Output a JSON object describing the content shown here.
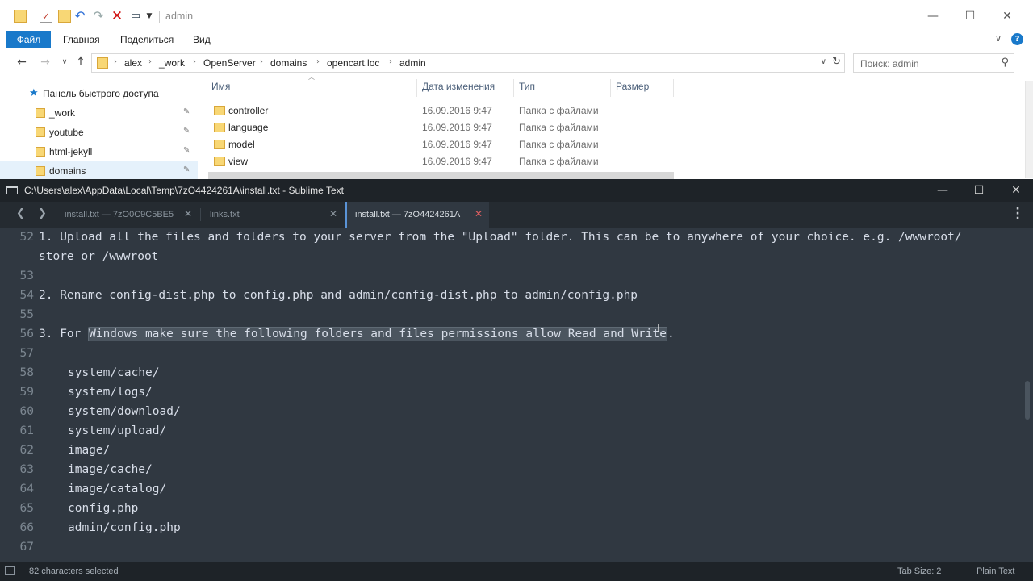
{
  "explorer": {
    "window_title": "admin",
    "ribbon_tabs": [
      "Файл",
      "Главная",
      "Поделиться",
      "Вид"
    ],
    "breadcrumb": [
      "alex",
      "_work",
      "OpenServer",
      "domains",
      "opencart.loc",
      "admin"
    ],
    "search_placeholder": "Поиск: admin",
    "quick_access_label": "Панель быстрого доступа",
    "nav_items": [
      "_work",
      "youtube",
      "html-jekyll",
      "domains"
    ],
    "columns": [
      "Имя",
      "Дата изменения",
      "Тип",
      "Размер"
    ],
    "files": [
      {
        "name": "controller",
        "date": "16.09.2016 9:47",
        "type": "Папка с файлами"
      },
      {
        "name": "language",
        "date": "16.09.2016 9:47",
        "type": "Папка с файлами"
      },
      {
        "name": "model",
        "date": "16.09.2016 9:47",
        "type": "Папка с файлами"
      },
      {
        "name": "view",
        "date": "16.09.2016 9:47",
        "type": "Папка с файлами"
      }
    ]
  },
  "sublime": {
    "title": "C:\\Users\\alex\\AppData\\Local\\Temp\\7zO4424261A\\install.txt - Sublime Text",
    "tabs": [
      {
        "label": "install.txt — 7zO0C9C5BE5",
        "active": false
      },
      {
        "label": "links.txt",
        "active": false
      },
      {
        "label": "install.txt — 7zO4424261A",
        "active": true
      }
    ],
    "lines": [
      {
        "num": "52",
        "text": "1. Upload all the files and folders to your server from the \"Upload\" folder. This can be to anywhere of your choice. e.g. /wwwroot/"
      },
      {
        "num": "",
        "text": "store or /wwwroot"
      },
      {
        "num": "53",
        "text": ""
      },
      {
        "num": "54",
        "text": "2. Rename config-dist.php to config.php and admin/config-dist.php to admin/config.php"
      },
      {
        "num": "55",
        "text": ""
      },
      {
        "num": "56",
        "text_before": "3. For ",
        "text_selected": "Windows make sure the following folders and files permissions allow Read and Write",
        "text_after": "."
      },
      {
        "num": "57",
        "text": ""
      },
      {
        "num": "58",
        "text": "system/cache/"
      },
      {
        "num": "59",
        "text": "system/logs/"
      },
      {
        "num": "60",
        "text": "system/download/"
      },
      {
        "num": "61",
        "text": "system/upload/"
      },
      {
        "num": "62",
        "text": "image/"
      },
      {
        "num": "63",
        "text": "image/cache/"
      },
      {
        "num": "64",
        "text": "image/catalog/"
      },
      {
        "num": "65",
        "text": "config.php"
      },
      {
        "num": "66",
        "text": "admin/config.php"
      },
      {
        "num": "67",
        "text": ""
      }
    ],
    "status_left": "82 characters selected",
    "tab_size": "Tab Size: 2",
    "syntax": "Plain Text"
  }
}
